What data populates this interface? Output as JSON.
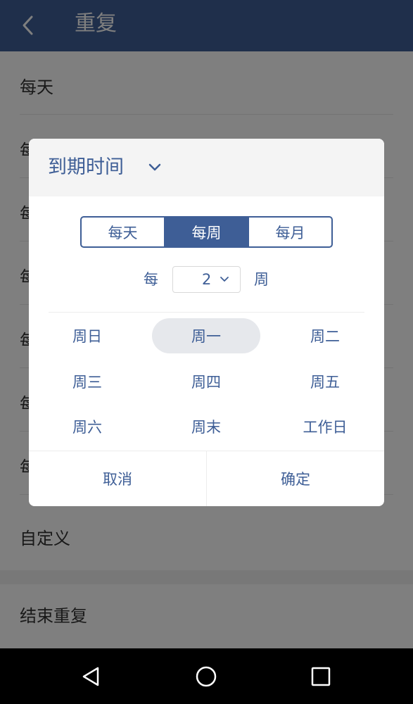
{
  "appbar": {
    "title": "重复",
    "back_icon": "chevron-left-icon"
  },
  "list": {
    "items": [
      {
        "label": "每天"
      },
      {
        "label": "每"
      },
      {
        "label": "每"
      },
      {
        "label": "每"
      },
      {
        "label": "每"
      },
      {
        "label": "每"
      },
      {
        "label": "每"
      }
    ],
    "custom_label": "自定义",
    "end_repeat_label": "结束重复"
  },
  "dialog": {
    "title": "到期时间",
    "title_icon": "chevron-down-icon",
    "tabs": [
      {
        "label": "每天",
        "active": false
      },
      {
        "label": "每周",
        "active": true
      },
      {
        "label": "每月",
        "active": false
      }
    ],
    "interval": {
      "prefix": "每",
      "value": "2",
      "unit": "周"
    },
    "days": [
      {
        "label": "周日",
        "selected": false
      },
      {
        "label": "周一",
        "selected": true
      },
      {
        "label": "周二",
        "selected": false
      },
      {
        "label": "周三",
        "selected": false
      },
      {
        "label": "周四",
        "selected": false
      },
      {
        "label": "周五",
        "selected": false
      },
      {
        "label": "周六",
        "selected": false
      },
      {
        "label": "周末",
        "selected": false
      },
      {
        "label": "工作日",
        "selected": false
      }
    ],
    "cancel_label": "取消",
    "confirm_label": "确定"
  },
  "navbar": {
    "back": "triangle-back-icon",
    "home": "circle-home-icon",
    "recents": "square-recents-icon"
  },
  "colors": {
    "accent": "#3e5e96",
    "selected_day": "#e6e8ec",
    "header_bg": "#f4f4f4"
  }
}
